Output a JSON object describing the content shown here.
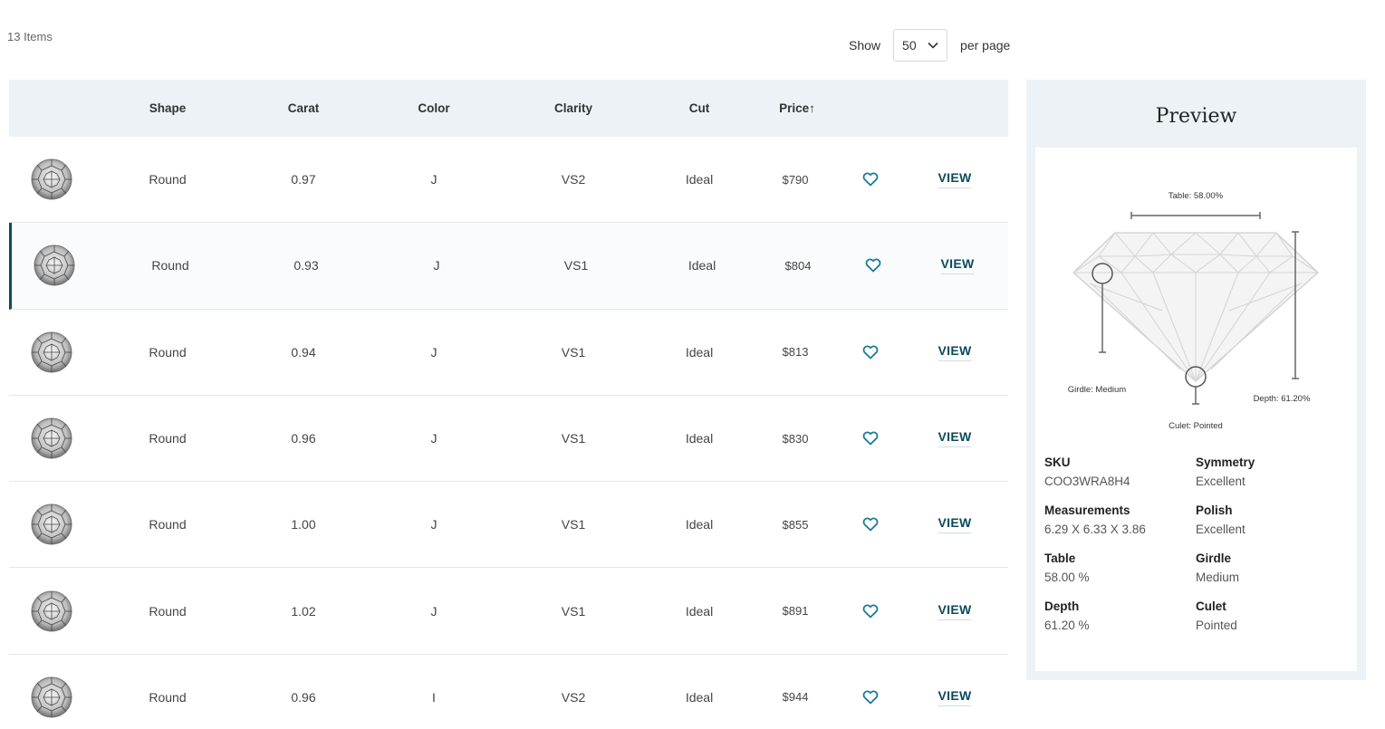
{
  "items_count": "13 Items",
  "pager": {
    "show_label": "Show",
    "per_page_value": "50",
    "per_page_label": "per page"
  },
  "table": {
    "headers": {
      "shape": "Shape",
      "carat": "Carat",
      "color": "Color",
      "clarity": "Clarity",
      "cut": "Cut",
      "price": "Price↑"
    },
    "view_label": "VIEW",
    "rows": [
      {
        "shape": "Round",
        "carat": "0.97",
        "color": "J",
        "clarity": "VS2",
        "cut": "Ideal",
        "price": "$790"
      },
      {
        "shape": "Round",
        "carat": "0.93",
        "color": "J",
        "clarity": "VS1",
        "cut": "Ideal",
        "price": "$804"
      },
      {
        "shape": "Round",
        "carat": "0.94",
        "color": "J",
        "clarity": "VS1",
        "cut": "Ideal",
        "price": "$813"
      },
      {
        "shape": "Round",
        "carat": "0.96",
        "color": "J",
        "clarity": "VS1",
        "cut": "Ideal",
        "price": "$830"
      },
      {
        "shape": "Round",
        "carat": "1.00",
        "color": "J",
        "clarity": "VS1",
        "cut": "Ideal",
        "price": "$855"
      },
      {
        "shape": "Round",
        "carat": "1.02",
        "color": "J",
        "clarity": "VS1",
        "cut": "Ideal",
        "price": "$891"
      },
      {
        "shape": "Round",
        "carat": "0.96",
        "color": "I",
        "clarity": "VS2",
        "cut": "Ideal",
        "price": "$944"
      }
    ]
  },
  "preview": {
    "title": "Preview",
    "diagram": {
      "table": "Table: 58.00%",
      "girdle": "Girdle: Medium",
      "depth": "Depth: 61.20%",
      "culet": "Culet: Pointed"
    },
    "specs": [
      {
        "label": "SKU",
        "value": "COO3WRA8H4"
      },
      {
        "label": "Symmetry",
        "value": "Excellent"
      },
      {
        "label": "Measurements",
        "value": "6.29 X 6.33 X 3.86"
      },
      {
        "label": "Polish",
        "value": "Excellent"
      },
      {
        "label": "Table",
        "value": "58.00 %"
      },
      {
        "label": "Girdle",
        "value": "Medium"
      },
      {
        "label": "Depth",
        "value": "61.20 %"
      },
      {
        "label": "Culet",
        "value": "Pointed"
      }
    ]
  },
  "colors": {
    "accent": "#0b4b5c",
    "heart": "#1b7a9a",
    "header_bg": "#edf2f6"
  },
  "icons": {
    "gem": "round-diamond-icon",
    "favorite": "heart-icon",
    "dropdown": "chevron-down-icon"
  }
}
